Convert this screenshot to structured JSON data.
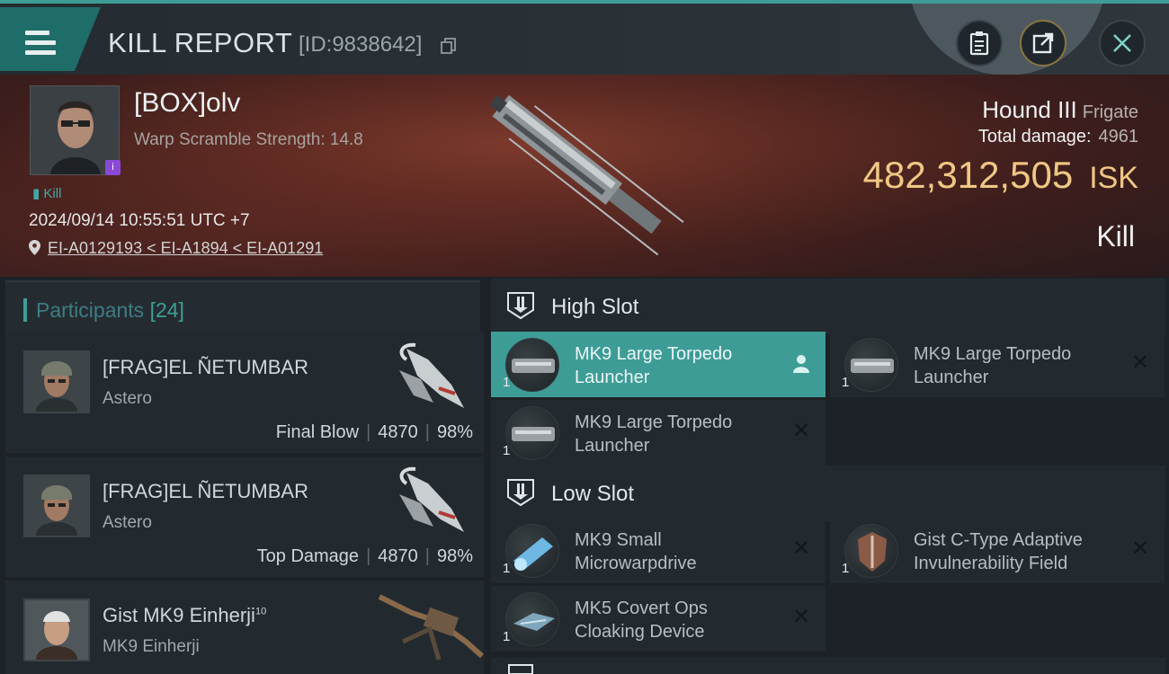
{
  "header": {
    "title": "KILL REPORT",
    "report_id": "[ID:9838642]",
    "buttons": {
      "clipboard": "clipboard-icon",
      "share": "share-icon",
      "close": "close-icon"
    },
    "accent": "#3d9c96"
  },
  "victim": {
    "name": "[BOX]olv",
    "scramble": "Warp Scramble Strength: 14.8",
    "kill_tag": "Kill",
    "timestamp": "2024/09/14 10:55:51 UTC +7",
    "location": "EI-A0129193 < EI-A1894 < EI-A01291",
    "ship_name": "Hound III",
    "ship_class": "Frigate",
    "total_damage_label": "Total damage:",
    "total_damage": "4961",
    "isk_value": "482,312,505",
    "isk_unit": "ISK",
    "result": "Kill",
    "isk_color": "#f0c784"
  },
  "participants": {
    "title": "Participants",
    "count": "[24]",
    "rows": [
      {
        "name": "[FRAG]EL ÑETUMBAR",
        "ship": "Astero",
        "role": "Final Blow",
        "damage": "4870",
        "percent": "98%"
      },
      {
        "name": "[FRAG]EL ÑETUMBAR",
        "ship": "Astero",
        "role": "Top Damage",
        "damage": "4870",
        "percent": "98%"
      },
      {
        "name": "Gist MK9 Einherji",
        "name_sup": "10",
        "ship": "MK9 Einherji"
      }
    ]
  },
  "fitting": {
    "high_slot": {
      "title": "High Slot",
      "modules": [
        {
          "name": "MK9 Large Torpedo Launcher",
          "qty": "1",
          "action": "person-icon"
        },
        {
          "name": "MK9 Large Torpedo Launcher",
          "qty": "1",
          "action": "close-icon"
        },
        {
          "name": "MK9 Large Torpedo Launcher",
          "qty": "1",
          "action": "close-icon"
        }
      ]
    },
    "low_slot": {
      "title": "Low Slot",
      "modules": [
        {
          "name": "MK9 Small Microwarpdrive",
          "qty": "1",
          "action": "close-icon"
        },
        {
          "name": "Gist C-Type Adaptive Invulnerability Field",
          "qty": "1",
          "action": "close-icon"
        },
        {
          "name": "MK5 Covert Ops Cloaking Device",
          "qty": "1",
          "action": "close-icon"
        }
      ]
    }
  }
}
